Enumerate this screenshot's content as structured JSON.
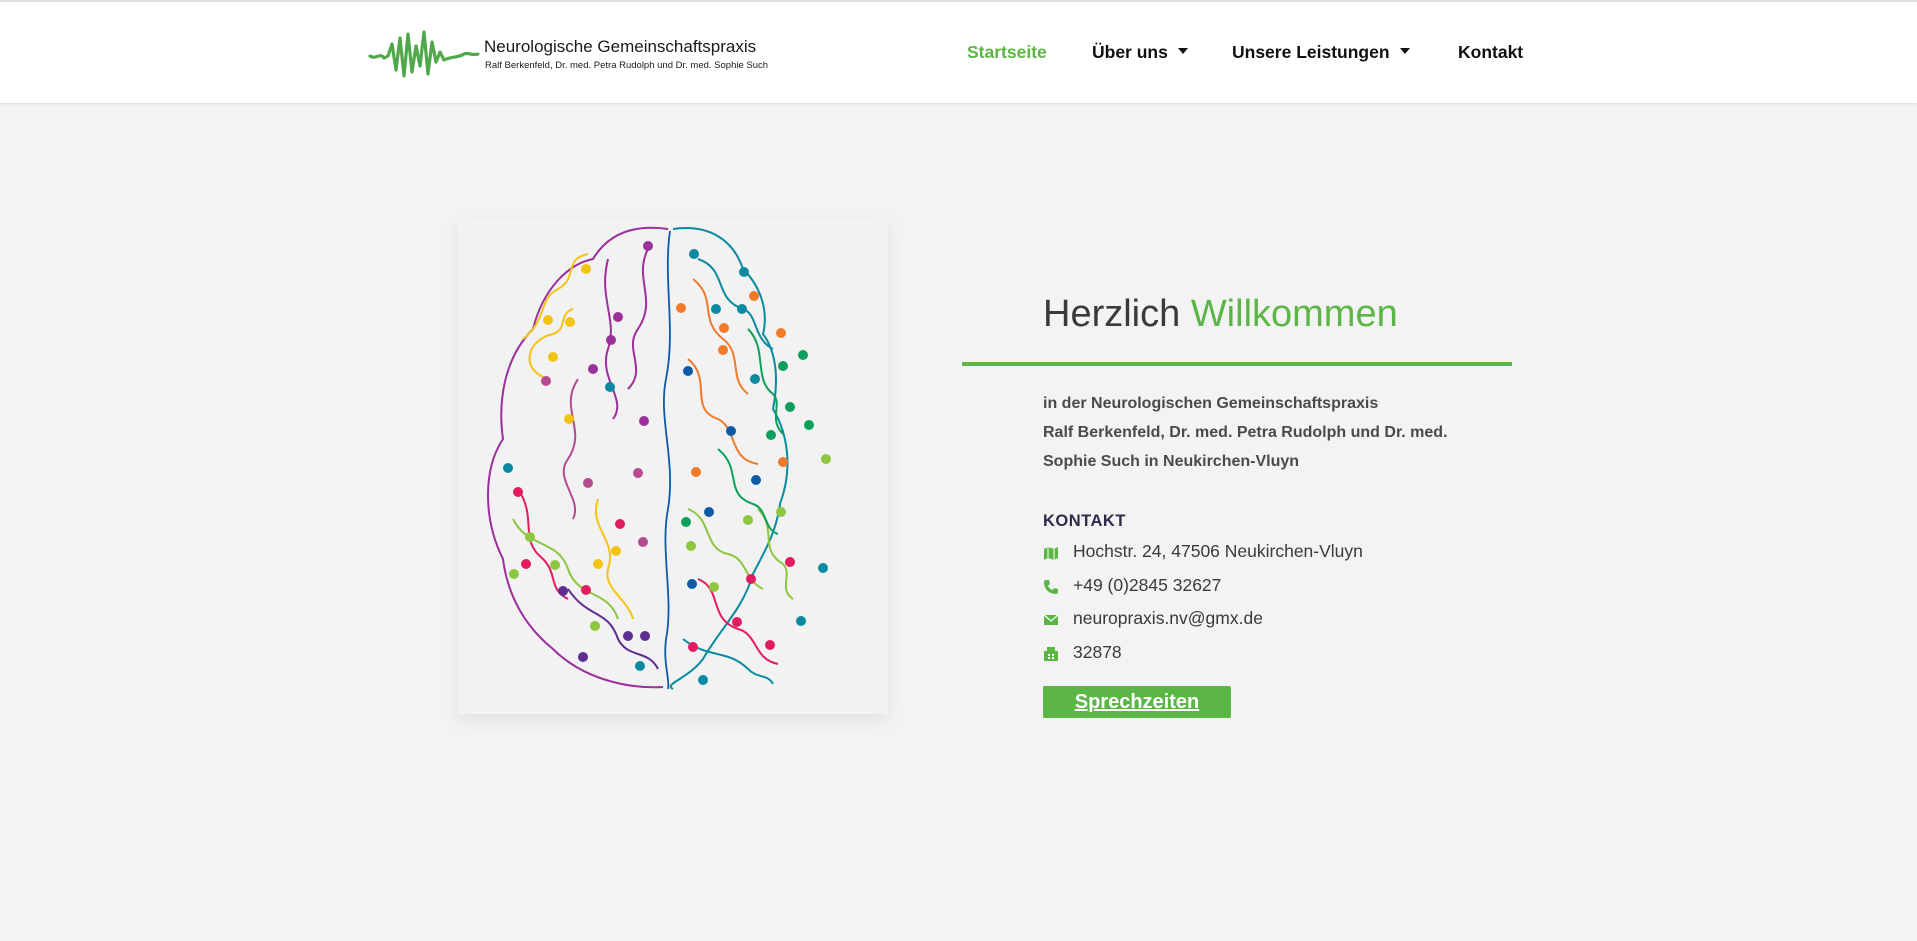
{
  "header": {
    "logo_title": "Neurologische Gemeinschaftspraxis",
    "logo_subtitle": "Ralf Berkenfeld, Dr. med. Petra Rudolph und Dr. med. Sophie Such",
    "logo_icon": "ecg-wave-icon",
    "nav": [
      {
        "label": "Startseite",
        "active": true,
        "dropdown": false
      },
      {
        "label": "Über uns",
        "active": false,
        "dropdown": true
      },
      {
        "label": "Unsere Leistungen",
        "active": false,
        "dropdown": true
      },
      {
        "label": "Kontakt",
        "active": false,
        "dropdown": false
      }
    ]
  },
  "hero": {
    "image": "colorful-brain-illustration",
    "title_part1": "Herzlich",
    "title_part2": "Willkommen",
    "intro_lines": [
      "in der Neurologischen Gemeinschaftspraxis",
      "Ralf Berkenfeld, Dr. med. Petra Rudolph und Dr. med.",
      "Sophie Such in Neukirchen-Vluyn"
    ]
  },
  "contact": {
    "heading": "KONTAKT",
    "items": [
      {
        "icon": "map-icon",
        "text": "Hochstr. 24, 47506 Neukirchen-Vluyn"
      },
      {
        "icon": "phone-icon",
        "text": "+49 (0)2845 32627"
      },
      {
        "icon": "envelope-icon",
        "text": "neuropraxis.nv@gmx.de"
      },
      {
        "icon": "fax-icon",
        "text": "32878"
      }
    ],
    "button_label": "Sprechzeiten"
  },
  "colors": {
    "accent": "#5bb646",
    "text": "#3a3a3a",
    "background": "#f3f3f3"
  }
}
